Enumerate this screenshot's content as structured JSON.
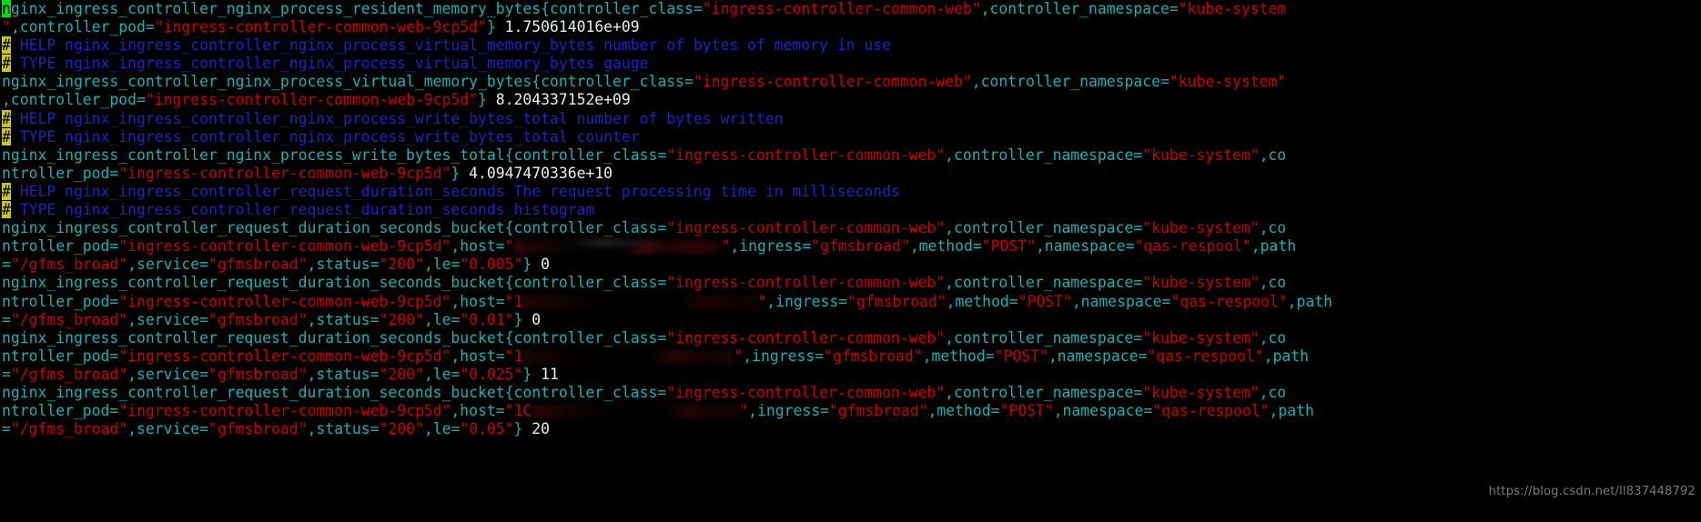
{
  "terminal": {
    "background": "#000000",
    "colors": {
      "metric_key": "#18b2b2",
      "string_value": "#c80000",
      "number": "#e6f2f2",
      "comment": "#2020c8",
      "hash_highlight_bg": "#c8c820",
      "cursor_bg": "#00e000",
      "watermark": "#7a7a7a"
    },
    "cursor_char": "n",
    "watermark": "https://blog.csdn.net/ll837448792"
  },
  "lines": [
    {
      "id": "l1",
      "type": "sample",
      "segments": [
        {
          "cls": "cursor",
          "text": "n"
        },
        {
          "cls": "k",
          "text": "ginx_ingress_controller_nginx_process_resident_memory_bytes{controller_class="
        },
        {
          "cls": "v",
          "text": "\"ingress-controller-common-web\""
        },
        {
          "cls": "k",
          "text": ",controller_namespace="
        },
        {
          "cls": "v",
          "text": "\"kube-system"
        }
      ]
    },
    {
      "id": "l2",
      "type": "sample-cont",
      "segments": [
        {
          "cls": "v",
          "text": "\""
        },
        {
          "cls": "k",
          "text": ",controller_pod="
        },
        {
          "cls": "v",
          "text": "\"ingress-controller-common-web-9cp5d\""
        },
        {
          "cls": "k",
          "text": "}"
        },
        {
          "cls": "n",
          "text": " 1.750614016e+09"
        }
      ]
    },
    {
      "id": "l3",
      "type": "help",
      "segments": [
        {
          "cls": "hash",
          "text": "#"
        },
        {
          "cls": "c",
          "text": " HELP nginx_ingress_controller_nginx_process_virtual_memory_bytes number of bytes of memory in use"
        }
      ]
    },
    {
      "id": "l4",
      "type": "type",
      "segments": [
        {
          "cls": "hash",
          "text": "#"
        },
        {
          "cls": "c",
          "text": " TYPE nginx_ingress_controller_nginx_process_virtual_memory_bytes gauge"
        }
      ]
    },
    {
      "id": "l5",
      "type": "sample",
      "segments": [
        {
          "cls": "k",
          "text": "nginx_ingress_controller_nginx_process_virtual_memory_bytes{controller_class="
        },
        {
          "cls": "v",
          "text": "\"ingress-controller-common-web\""
        },
        {
          "cls": "k",
          "text": ",controller_namespace="
        },
        {
          "cls": "v",
          "text": "\"kube-system\""
        }
      ]
    },
    {
      "id": "l6",
      "type": "sample-cont",
      "segments": [
        {
          "cls": "k",
          "text": ",controller_pod="
        },
        {
          "cls": "v",
          "text": "\"ingress-controller-common-web-9cp5d\""
        },
        {
          "cls": "k",
          "text": "}"
        },
        {
          "cls": "n",
          "text": " 8.204337152e+09"
        }
      ]
    },
    {
      "id": "l7",
      "type": "help",
      "segments": [
        {
          "cls": "hash",
          "text": "#"
        },
        {
          "cls": "c",
          "text": " HELP nginx_ingress_controller_nginx_process_write_bytes_total number of bytes written"
        }
      ]
    },
    {
      "id": "l8",
      "type": "type",
      "segments": [
        {
          "cls": "hash",
          "text": "#"
        },
        {
          "cls": "c",
          "text": " TYPE nginx_ingress_controller_nginx_process_write_bytes_total counter"
        }
      ]
    },
    {
      "id": "l9",
      "type": "sample",
      "segments": [
        {
          "cls": "k",
          "text": "nginx_ingress_controller_nginx_process_write_bytes_total{controller_class="
        },
        {
          "cls": "v",
          "text": "\"ingress-controller-common-web\""
        },
        {
          "cls": "k",
          "text": ",controller_namespace="
        },
        {
          "cls": "v",
          "text": "\"kube-system\""
        },
        {
          "cls": "k",
          "text": ",co"
        }
      ]
    },
    {
      "id": "l10",
      "type": "sample-cont",
      "segments": [
        {
          "cls": "k",
          "text": "ntroller_pod="
        },
        {
          "cls": "v",
          "text": "\"ingress-controller-common-web-9cp5d\""
        },
        {
          "cls": "k",
          "text": "}"
        },
        {
          "cls": "n",
          "text": " 4.0947470336e+10"
        }
      ]
    },
    {
      "id": "l11",
      "type": "help",
      "segments": [
        {
          "cls": "hash",
          "text": "#"
        },
        {
          "cls": "c",
          "text": " HELP nginx_ingress_controller_request_duration_seconds The request processing time in milliseconds"
        }
      ]
    },
    {
      "id": "l12",
      "type": "type",
      "segments": [
        {
          "cls": "hash",
          "text": "#"
        },
        {
          "cls": "c",
          "text": " TYPE nginx_ingress_controller_request_duration_seconds histogram"
        }
      ]
    },
    {
      "id": "l13",
      "type": "sample",
      "segments": [
        {
          "cls": "k",
          "text": "nginx_ingress_controller_request_duration_seconds_bucket{controller_class="
        },
        {
          "cls": "v",
          "text": "\"ingress-controller-common-web\""
        },
        {
          "cls": "k",
          "text": ",controller_namespace="
        },
        {
          "cls": "v",
          "text": "\"kube-system\""
        },
        {
          "cls": "k",
          "text": ",co"
        }
      ]
    },
    {
      "id": "l14",
      "type": "sample-cont-redacted",
      "redact_class": "r1",
      "segments_before": [
        {
          "cls": "k",
          "text": "ntroller_pod="
        },
        {
          "cls": "v",
          "text": "\"ingress-controller-common-web-9cp5d\""
        },
        {
          "cls": "k",
          "text": ",host="
        },
        {
          "cls": "v",
          "text": "\""
        }
      ],
      "segments_after": [
        {
          "cls": "v",
          "text": "\""
        },
        {
          "cls": "k",
          "text": ",ingress="
        },
        {
          "cls": "v",
          "text": "\"gfmsbroad\""
        },
        {
          "cls": "k",
          "text": ",method="
        },
        {
          "cls": "v",
          "text": "\"POST\""
        },
        {
          "cls": "k",
          "text": ",namespace="
        },
        {
          "cls": "v",
          "text": "\"qas-respool\""
        },
        {
          "cls": "k",
          "text": ",path"
        }
      ]
    },
    {
      "id": "l15",
      "type": "sample-cont",
      "segments": [
        {
          "cls": "k",
          "text": "="
        },
        {
          "cls": "v",
          "text": "\"/gfms_broad\""
        },
        {
          "cls": "k",
          "text": ",service="
        },
        {
          "cls": "v",
          "text": "\"gfmsbroad\""
        },
        {
          "cls": "k",
          "text": ",status="
        },
        {
          "cls": "v",
          "text": "\"200\""
        },
        {
          "cls": "k",
          "text": ",le="
        },
        {
          "cls": "v",
          "text": "\"0.005\""
        },
        {
          "cls": "k",
          "text": "}"
        },
        {
          "cls": "n",
          "text": " 0"
        }
      ]
    },
    {
      "id": "l16",
      "type": "sample",
      "segments": [
        {
          "cls": "k",
          "text": "nginx_ingress_controller_request_duration_seconds_bucket{controller_class="
        },
        {
          "cls": "v",
          "text": "\"ingress-controller-common-web\""
        },
        {
          "cls": "k",
          "text": ",controller_namespace="
        },
        {
          "cls": "v",
          "text": "\"kube-system\""
        },
        {
          "cls": "k",
          "text": ",co"
        }
      ]
    },
    {
      "id": "l17",
      "type": "sample-cont-redacted",
      "redact_class": "r2",
      "segments_before": [
        {
          "cls": "k",
          "text": "ntroller_pod="
        },
        {
          "cls": "v",
          "text": "\"ingress-controller-common-web-9cp5d\""
        },
        {
          "cls": "k",
          "text": ",host="
        },
        {
          "cls": "v",
          "text": "\"1"
        }
      ],
      "segments_after": [
        {
          "cls": "v",
          "text": "\""
        },
        {
          "cls": "k",
          "text": ",ingress="
        },
        {
          "cls": "v",
          "text": "\"gfmsbroad\""
        },
        {
          "cls": "k",
          "text": ",method="
        },
        {
          "cls": "v",
          "text": "\"POST\""
        },
        {
          "cls": "k",
          "text": ",namespace="
        },
        {
          "cls": "v",
          "text": "\"qas-respool\""
        },
        {
          "cls": "k",
          "text": ",path"
        }
      ]
    },
    {
      "id": "l18",
      "type": "sample-cont",
      "segments": [
        {
          "cls": "k",
          "text": "="
        },
        {
          "cls": "v",
          "text": "\"/gfms_broad\""
        },
        {
          "cls": "k",
          "text": ",service="
        },
        {
          "cls": "v",
          "text": "\"gfmsbroad\""
        },
        {
          "cls": "k",
          "text": ",status="
        },
        {
          "cls": "v",
          "text": "\"200\""
        },
        {
          "cls": "k",
          "text": ",le="
        },
        {
          "cls": "v",
          "text": "\"0.01\""
        },
        {
          "cls": "k",
          "text": "}"
        },
        {
          "cls": "n",
          "text": " 0"
        }
      ]
    },
    {
      "id": "l19",
      "type": "sample",
      "segments": [
        {
          "cls": "k",
          "text": "nginx_ingress_controller_request_duration_seconds_bucket{controller_class="
        },
        {
          "cls": "v",
          "text": "\"ingress-controller-common-web\""
        },
        {
          "cls": "k",
          "text": ",controller_namespace="
        },
        {
          "cls": "v",
          "text": "\"kube-system\""
        },
        {
          "cls": "k",
          "text": ",co"
        }
      ]
    },
    {
      "id": "l20",
      "type": "sample-cont-redacted",
      "redact_class": "r3",
      "segments_before": [
        {
          "cls": "k",
          "text": "ntroller_pod="
        },
        {
          "cls": "v",
          "text": "\"ingress-controller-common-web-9cp5d\""
        },
        {
          "cls": "k",
          "text": ",host="
        },
        {
          "cls": "v",
          "text": "\"1"
        }
      ],
      "segments_after": [
        {
          "cls": "v",
          "text": "\""
        },
        {
          "cls": "k",
          "text": ",ingress="
        },
        {
          "cls": "v",
          "text": "\"gfmsbroad\""
        },
        {
          "cls": "k",
          "text": ",method="
        },
        {
          "cls": "v",
          "text": "\"POST\""
        },
        {
          "cls": "k",
          "text": ",namespace="
        },
        {
          "cls": "v",
          "text": "\"qas-respool\""
        },
        {
          "cls": "k",
          "text": ",path"
        }
      ]
    },
    {
      "id": "l21",
      "type": "sample-cont",
      "segments": [
        {
          "cls": "k",
          "text": "="
        },
        {
          "cls": "v",
          "text": "\"/gfms_broad\""
        },
        {
          "cls": "k",
          "text": ",service="
        },
        {
          "cls": "v",
          "text": "\"gfmsbroad\""
        },
        {
          "cls": "k",
          "text": ",status="
        },
        {
          "cls": "v",
          "text": "\"200\""
        },
        {
          "cls": "k",
          "text": ",le="
        },
        {
          "cls": "v",
          "text": "\"0.025\""
        },
        {
          "cls": "k",
          "text": "}"
        },
        {
          "cls": "n",
          "text": " 11"
        }
      ]
    },
    {
      "id": "l22",
      "type": "sample",
      "segments": [
        {
          "cls": "k",
          "text": "nginx_ingress_controller_request_duration_seconds_bucket{controller_class="
        },
        {
          "cls": "v",
          "text": "\"ingress-controller-common-web\""
        },
        {
          "cls": "k",
          "text": ",controller_namespace="
        },
        {
          "cls": "v",
          "text": "\"kube-system\""
        },
        {
          "cls": "k",
          "text": ",co"
        }
      ]
    },
    {
      "id": "l23",
      "type": "sample-cont-redacted",
      "redact_class": "r4",
      "segments_before": [
        {
          "cls": "k",
          "text": "ntroller_pod="
        },
        {
          "cls": "v",
          "text": "\"ingress-controller-common-web-9cp5d\""
        },
        {
          "cls": "k",
          "text": ",host="
        },
        {
          "cls": "v",
          "text": "\"1C"
        }
      ],
      "segments_after": [
        {
          "cls": "v",
          "text": "\""
        },
        {
          "cls": "k",
          "text": ",ingress="
        },
        {
          "cls": "v",
          "text": "\"gfmsbroad\""
        },
        {
          "cls": "k",
          "text": ",method="
        },
        {
          "cls": "v",
          "text": "\"POST\""
        },
        {
          "cls": "k",
          "text": ",namespace="
        },
        {
          "cls": "v",
          "text": "\"qas-respool\""
        },
        {
          "cls": "k",
          "text": ",path"
        }
      ]
    },
    {
      "id": "l24",
      "type": "sample-cont",
      "segments": [
        {
          "cls": "k",
          "text": "="
        },
        {
          "cls": "v",
          "text": "\"/gfms_broad\""
        },
        {
          "cls": "k",
          "text": ",service="
        },
        {
          "cls": "v",
          "text": "\"gfmsbroad\""
        },
        {
          "cls": "k",
          "text": ",status="
        },
        {
          "cls": "v",
          "text": "\"200\""
        },
        {
          "cls": "k",
          "text": ",le="
        },
        {
          "cls": "v",
          "text": "\"0.05\""
        },
        {
          "cls": "k",
          "text": "}"
        },
        {
          "cls": "n",
          "text": " 20"
        }
      ]
    }
  ]
}
